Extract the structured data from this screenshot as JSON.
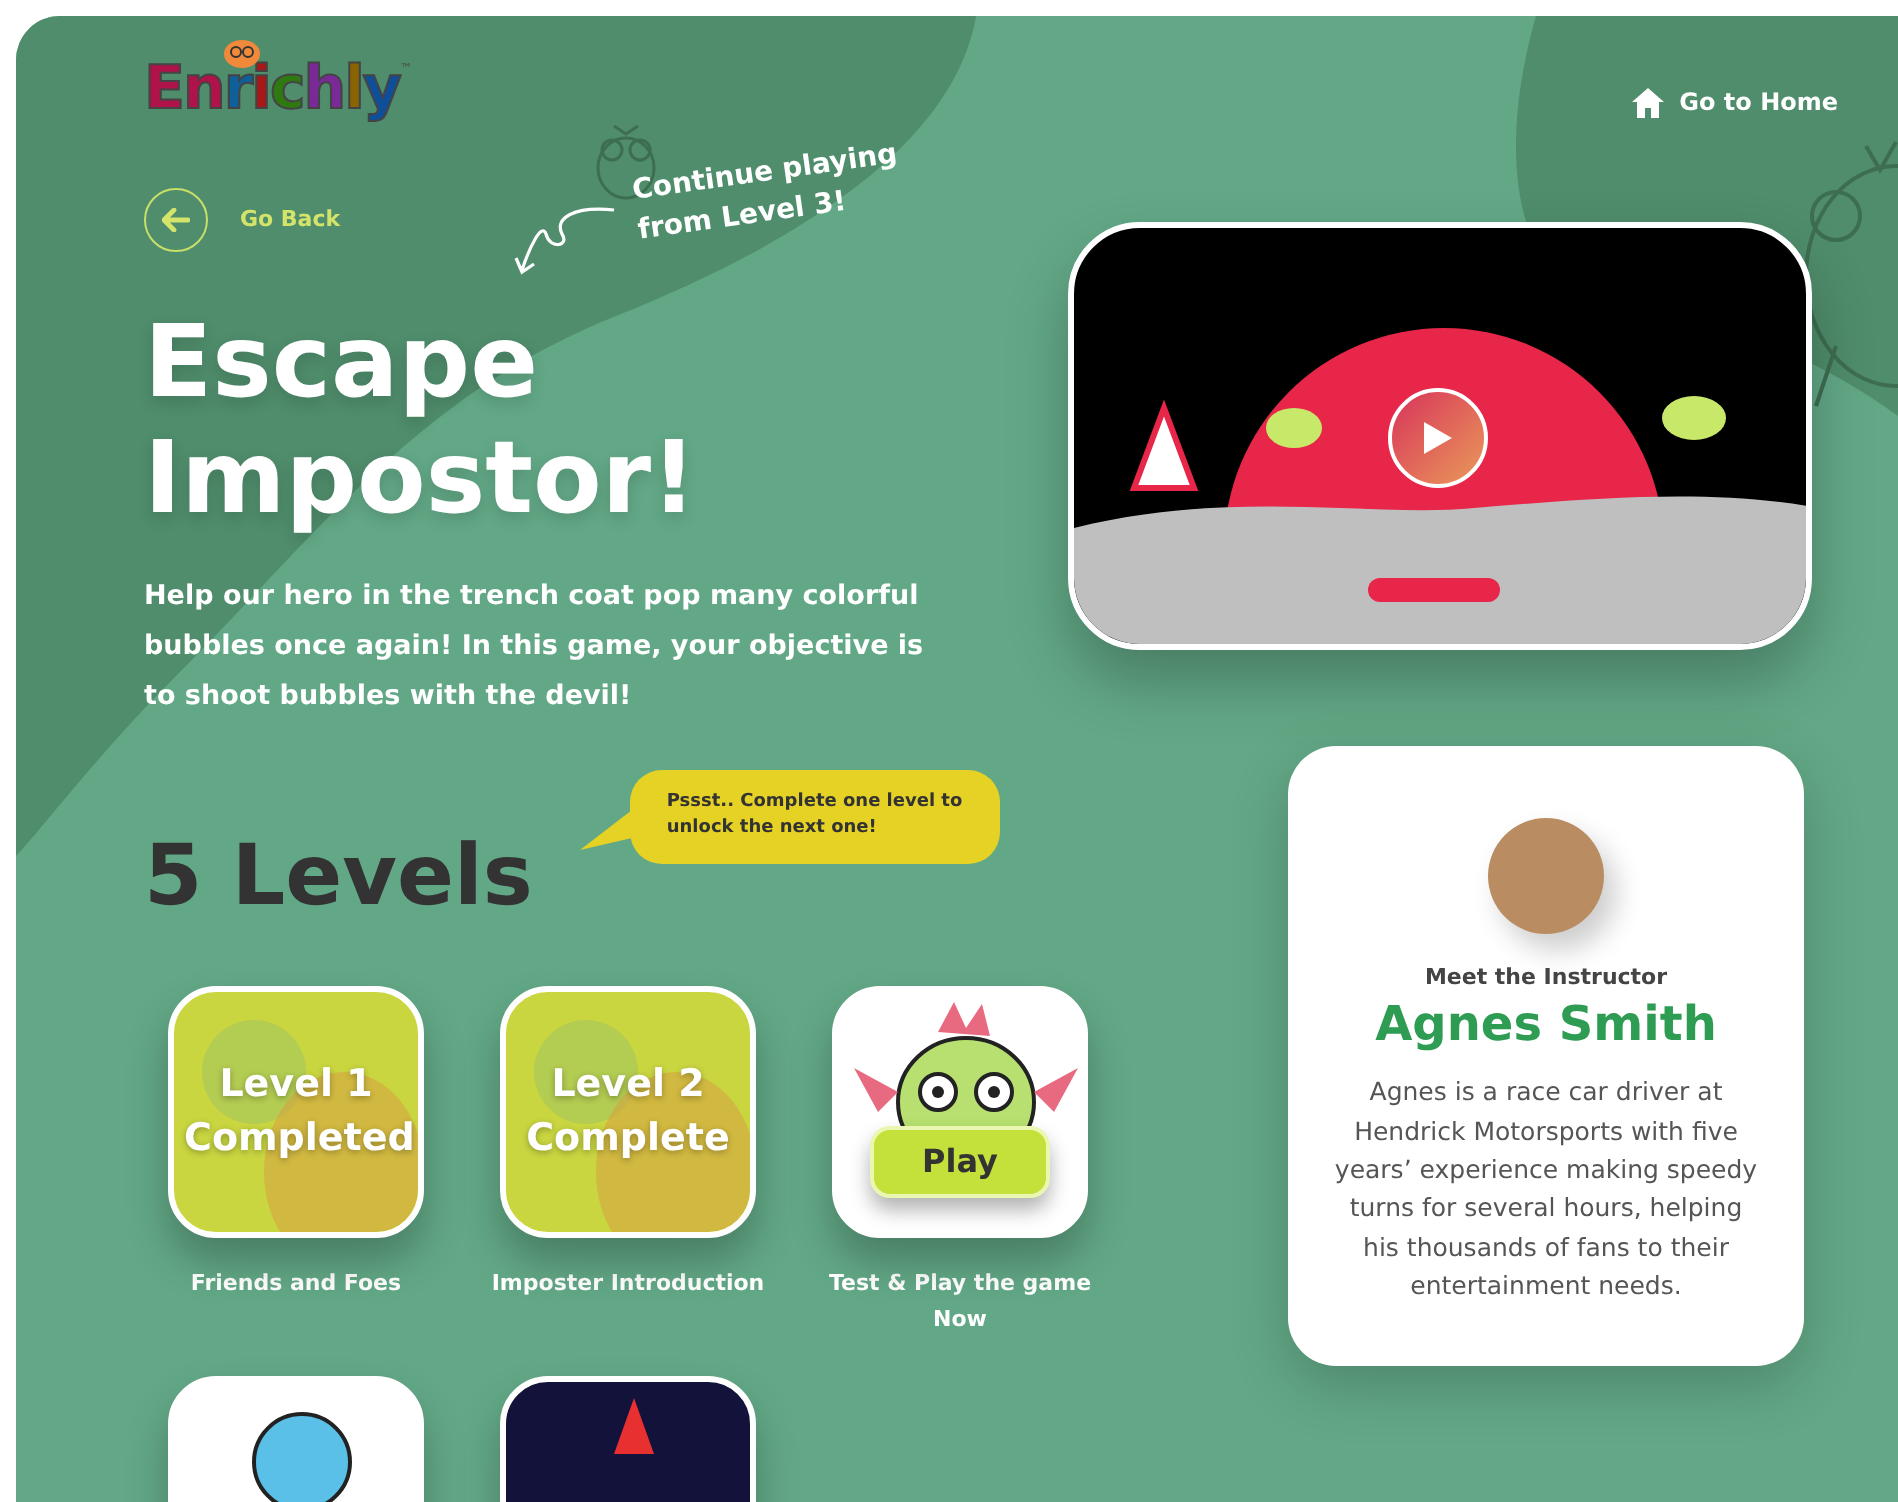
{
  "header": {
    "logo": "Enrichly",
    "logo_mark": "™",
    "home_link": "Go to Home"
  },
  "back_link": "Go Back",
  "hint_note": "Continue playing from Level 3!",
  "game": {
    "title": "Escape Impostor!",
    "description": "Help our hero in the trench coat pop many colorful bubbles once again! In this game, your objective is to shoot bubbles with the devil!"
  },
  "levels_section": {
    "heading": "5 Levels",
    "tip": "Pssst.. Complete one level to unlock the next one!"
  },
  "levels": [
    {
      "kind": "completed",
      "overlay": "Level 1 Completed",
      "caption": "Friends and Foes"
    },
    {
      "kind": "completed",
      "overlay": "Level 2 Complete",
      "caption": "Imposter Introduction"
    },
    {
      "kind": "current",
      "button": "Play",
      "caption": "Test & Play the game Now"
    },
    {
      "kind": "upcoming"
    },
    {
      "kind": "upcoming"
    }
  ],
  "instructor": {
    "label": "Meet the Instructor",
    "name": "Agnes Smith",
    "bio": "Agnes is a race car driver at Hendrick Motorsports with five years’ experience making speedy turns for several hours, helping his thousands of fans to their entertainment needs."
  }
}
